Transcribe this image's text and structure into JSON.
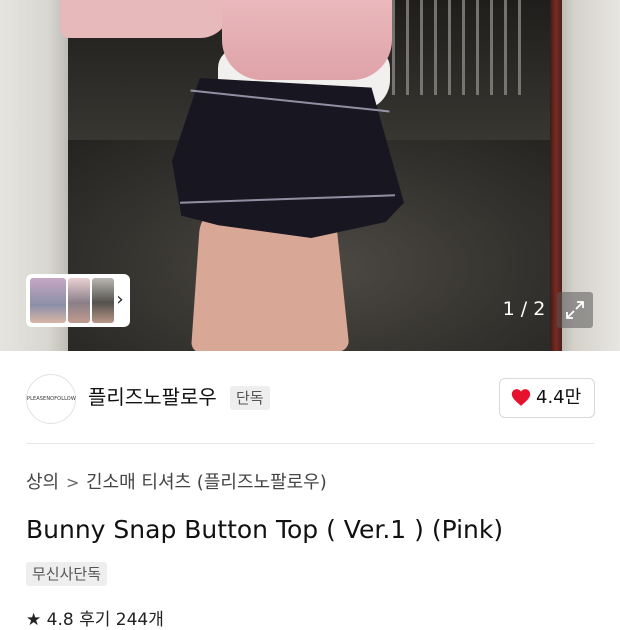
{
  "gallery": {
    "counter": "1 / 2",
    "thumbnail_chevron": "chevron-right-icon",
    "expand_icon": "expand-icon"
  },
  "brand": {
    "logo_text": "PLEASENOFOLLOW",
    "name": "플리즈노팔로우",
    "tag": "단독",
    "like_icon": "heart-icon",
    "like_count": "4.4만",
    "heart_color": "#e8112d"
  },
  "breadcrumb": {
    "category": "상의",
    "separator": ">",
    "subcategory": "긴소매 티셔츠 (플리즈노팔로우)"
  },
  "product": {
    "title": "Bunny Snap Button Top ( Ver.1 ) (Pink)",
    "badge": "무신사단독",
    "rating_peek": "★ 4.8 후기 244개"
  }
}
